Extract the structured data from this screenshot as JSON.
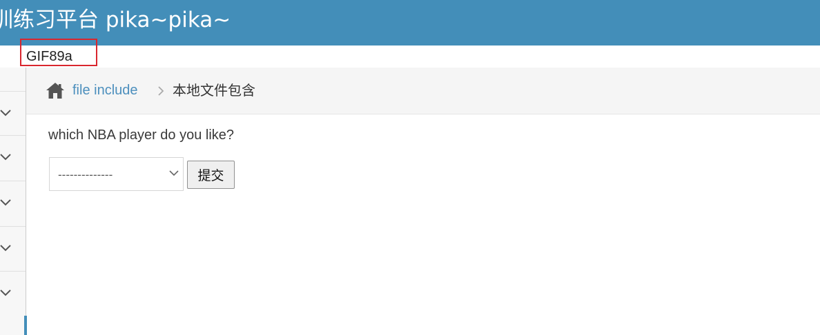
{
  "header": {
    "title": "训练习平台 pika~pika~"
  },
  "injected_output": {
    "text": "GIF89a"
  },
  "breadcrumb": {
    "link_label": "file include",
    "current_label": "本地文件包含"
  },
  "form": {
    "question": "which NBA player do you like?",
    "select_value": "--------------",
    "submit_label": "提交"
  },
  "colors": {
    "header_bg": "#438eb9",
    "highlight_box": "#d9262e",
    "link": "#4c8fbd"
  },
  "icons": [
    "home-icon",
    "chevron-right-icon",
    "chevron-down-icon"
  ]
}
